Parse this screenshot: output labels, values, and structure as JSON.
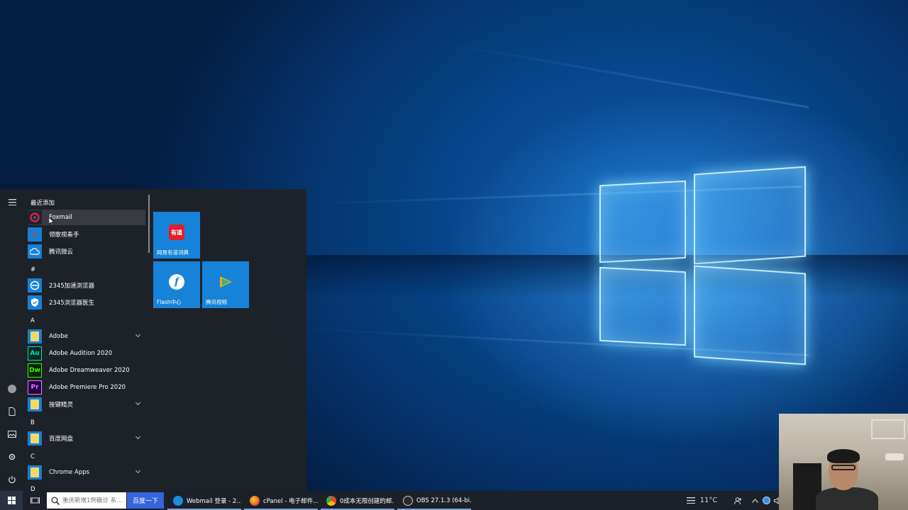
{
  "start_menu": {
    "recent_header": "最近添加",
    "recent_items": [
      {
        "label": "Foxmail",
        "icon": "foxmail-icon"
      },
      {
        "label": "领歌视奏手",
        "icon": "app-icon"
      },
      {
        "label": "腾讯微云",
        "icon": "cloud-icon"
      }
    ],
    "groups": [
      {
        "letter": "#",
        "items": [
          {
            "label": "2345加速浏览器",
            "icon": "browser-icon"
          },
          {
            "label": "2345浏览器医生",
            "icon": "shield-icon"
          }
        ]
      },
      {
        "letter": "A",
        "items": [
          {
            "label": "Adobe",
            "icon": "folder-icon",
            "expandable": true
          },
          {
            "label": "Adobe Audition 2020",
            "icon": "audition-icon",
            "badge": "Au"
          },
          {
            "label": "Adobe Dreamweaver 2020",
            "icon": "dreamweaver-icon",
            "badge": "Dw"
          },
          {
            "label": "Adobe Premiere Pro 2020",
            "icon": "premiere-icon",
            "badge": "Pr"
          },
          {
            "label": "按键精灵",
            "icon": "folder-icon",
            "expandable": true
          }
        ]
      },
      {
        "letter": "B",
        "items": [
          {
            "label": "百度网盘",
            "icon": "folder-icon",
            "expandable": true
          }
        ]
      },
      {
        "letter": "C",
        "items": [
          {
            "label": "Chrome Apps",
            "icon": "folder-icon",
            "expandable": true
          }
        ]
      },
      {
        "letter": "D",
        "items": []
      }
    ],
    "tiles": [
      {
        "label": "网易有道词典",
        "icon_text": "有道"
      },
      {
        "label": "Flash中心",
        "icon_text": "f"
      },
      {
        "label": "腾讯视频",
        "icon_text": "▶"
      }
    ]
  },
  "taskbar": {
    "search_placeholder": "重庆新增1例确诊 系...",
    "search_button": "百度一下",
    "apps": [
      {
        "label": "Webmail 登录 - 2...",
        "color": "#1a8fe0"
      },
      {
        "label": "cPanel - 电子邮件...",
        "color": "#e8621c"
      },
      {
        "label": "0成本无限创建的邮...",
        "color": "#34a853"
      },
      {
        "label": "OBS 27.1.3 (64-bi...",
        "color": "#3a3a3a"
      }
    ],
    "weather": "11°C"
  },
  "colors": {
    "start_menu_bg": "#1e2228",
    "tile_blue": "#1683d8",
    "taskbar_bg": "#1b2029",
    "baidu_button": "#3565d8"
  }
}
